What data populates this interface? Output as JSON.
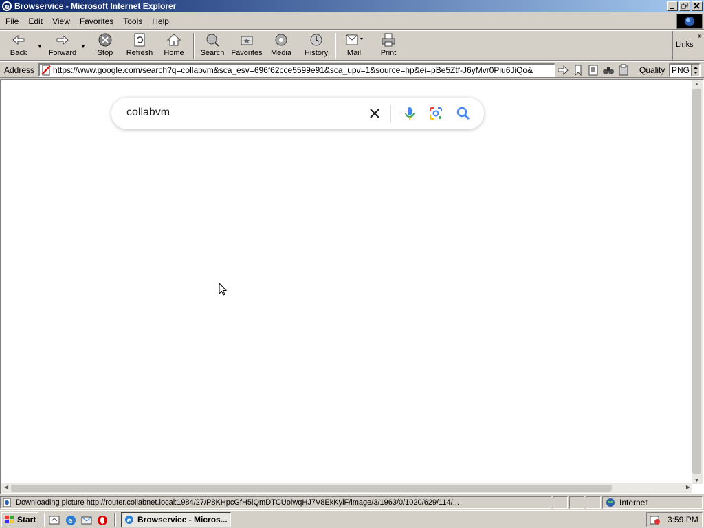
{
  "window": {
    "title": "Browservice - Microsoft Internet Explorer"
  },
  "menu": {
    "items": [
      {
        "acc": "F",
        "rest": "ile"
      },
      {
        "acc": "E",
        "rest": "dit"
      },
      {
        "acc": "V",
        "rest": "iew"
      },
      {
        "pre": "F",
        "acc": "a",
        "rest": "vorites"
      },
      {
        "acc": "T",
        "rest": "ools"
      },
      {
        "acc": "H",
        "rest": "elp"
      }
    ]
  },
  "toolbar": {
    "back": "Back",
    "forward": "Forward",
    "stop": "Stop",
    "refresh": "Refresh",
    "home": "Home",
    "search": "Search",
    "favorites": "Favorites",
    "media": "Media",
    "history": "History",
    "mail": "Mail",
    "print": "Print",
    "links": "Links"
  },
  "address": {
    "label": "Address",
    "url": "https://www.google.com/search?q=collabvm&sca_esv=696f62cce5599e91&sca_upv=1&source=hp&ei=pBe5Ztf-J6yMvr0Piu6JiQo&",
    "quality_label": "Quality",
    "quality_value": "PNG"
  },
  "search": {
    "query": "collabvm",
    "colors": {
      "blue": "#4285f4",
      "red": "#ea4335",
      "yellow": "#fbbc04",
      "green": "#34a853"
    }
  },
  "status": {
    "text": "Downloading picture http://router.collabnet.local:1984/27/P8KHpcGfH5lQmDTCUoiwqHJ7V8EkKylF/image/3/1963/0/1020/629/114/...",
    "zone": "Internet"
  },
  "taskbar": {
    "start": "Start",
    "task": "Browservice - Micros...",
    "clock": "3:59 PM"
  }
}
